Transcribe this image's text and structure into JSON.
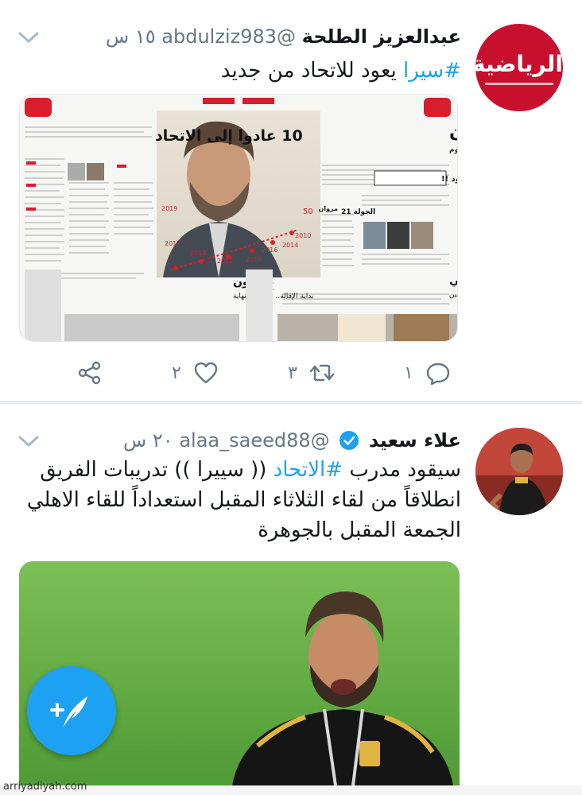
{
  "tweets": [
    {
      "avatar_logo_text": "الرياضية",
      "name": "عبدالعزيز الطلحة",
      "handle": "@abdulziz983",
      "time": "١٥ س",
      "hashtag": "#سيرا",
      "text": " يعود للاتحاد من جديد",
      "media": {
        "headline_left": "10 عادوا إلى الاتحاد",
        "headline_right": "شيئان",
        "subhead_right": "يعرفهما سيرا.. مذاق الانتصارات والحوم",
        "headline_bottom_left": "التعاون",
        "subhead_bottom_left": "بداية الإقالة.. والهلال النهاية",
        "headline_bottom_right": "الكرواتي",
        "subhead_bottom_right": "يقسم الاتحاديين",
        "box_text": "سيرا يعود !!",
        "round_label": "الجولة 21",
        "marwan_label": "مروان",
        "years": [
          "2019",
          "2017",
          "2013",
          "2012",
          "2019",
          "2016",
          "2014",
          "2010"
        ],
        "count_label": "50"
      },
      "reply_count": "١",
      "retweet_count": "٣",
      "like_count": "٢"
    },
    {
      "name": "علاء سعيد",
      "handle": "@alaa_saeed88",
      "time": "٢٠ س",
      "text_line1_a": "سيقود مدرب ",
      "hashtag": "#الاتحاد",
      "text_line1_b": " (( سييرا )) تدريبات الفريق",
      "text_line2": "انطلاقاً من لقاء الثلاثاء المقبل استعداداً للقاء الاهلي",
      "text_line3": "الجمعة المقبل بالجوهرة"
    }
  ],
  "watermark": "arriyadiyah.com",
  "colors": {
    "accent": "#1da1f2",
    "logo_red": "#c8102e",
    "secondary_text": "#657786"
  },
  "icons": [
    "chevron-down-icon",
    "verified-badge-icon",
    "reply-icon",
    "retweet-icon",
    "like-icon",
    "share-icon",
    "compose-tweet-icon"
  ]
}
